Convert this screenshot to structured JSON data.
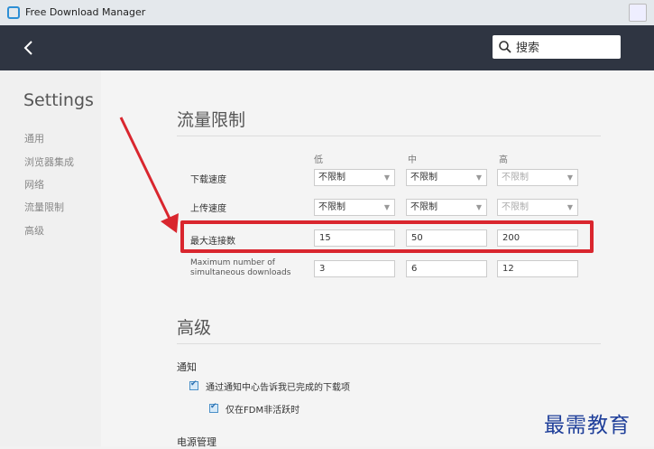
{
  "window": {
    "title": "Free Download Manager"
  },
  "topbar": {
    "back_icon": "back-arrow-icon",
    "search_icon": "search-icon",
    "search_placeholder": "搜索"
  },
  "sidebar": {
    "title": "Settings",
    "items": [
      {
        "label": "通用"
      },
      {
        "label": "浏览器集成"
      },
      {
        "label": "网络"
      },
      {
        "label": "流量限制"
      },
      {
        "label": "高级"
      }
    ]
  },
  "traffic": {
    "heading": "流量限制",
    "columns": [
      "低",
      "中",
      "高"
    ],
    "download_label": "下载速度",
    "upload_label": "上传速度",
    "download_values": [
      "不限制",
      "不限制",
      "不限制"
    ],
    "upload_values": [
      "不限制",
      "不限制",
      "不限制"
    ],
    "connections_label": "最大连接数",
    "connections_values": [
      "15",
      "50",
      "200"
    ],
    "simultaneous_label": "Maximum number of simultaneous downloads",
    "simultaneous_values": [
      "3",
      "6",
      "12"
    ]
  },
  "advanced": {
    "heading": "高级",
    "notify_heading": "通知",
    "notify_option1": "通过通知中心告诉我已完成的下载项",
    "notify_option2": "仅在FDM非活跃时",
    "power_heading": "电源管理"
  },
  "annotation": {
    "highlight_color": "#d9262e"
  },
  "watermark": "最需教育"
}
